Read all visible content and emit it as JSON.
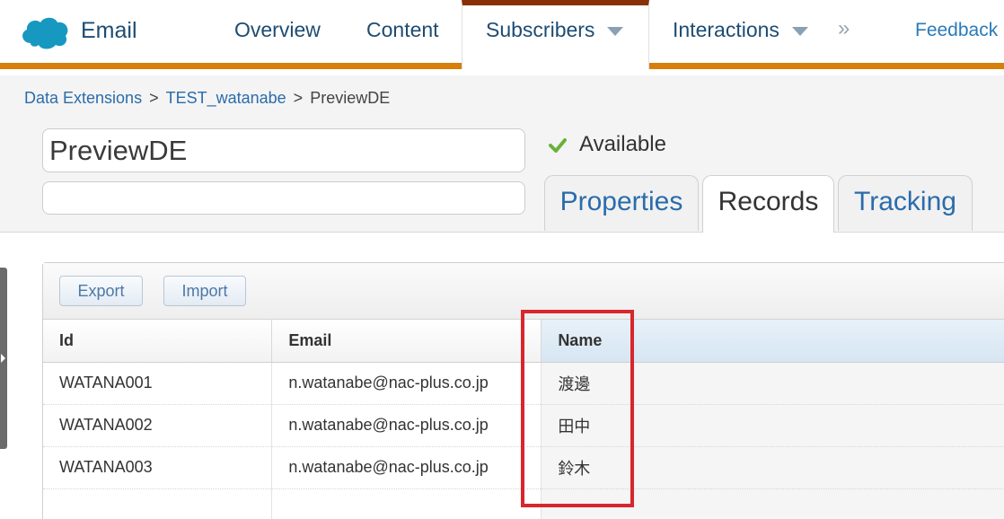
{
  "nav": {
    "app_name": "Email",
    "items": [
      "Overview",
      "Content",
      "Subscribers",
      "Interactions"
    ],
    "overflow": "»",
    "feedback": "Feedback",
    "active": "Subscribers"
  },
  "breadcrumb": {
    "items": [
      "Data Extensions",
      "TEST_watanabe",
      "PreviewDE"
    ],
    "separator": ">"
  },
  "data_extension": {
    "name": "PreviewDE",
    "description": "",
    "status": "Available"
  },
  "tabs": {
    "items": [
      "Properties",
      "Records",
      "Tracking"
    ],
    "active": "Records"
  },
  "toolbar": {
    "export_label": "Export",
    "import_label": "Import"
  },
  "table": {
    "columns": [
      "Id",
      "Email",
      "Name"
    ],
    "rows": [
      [
        "WATANA001",
        "n.watanabe@nac-plus.co.jp",
        "渡邊"
      ],
      [
        "WATANA002",
        "n.watanabe@nac-plus.co.jp",
        "田中"
      ],
      [
        "WATANA003",
        "n.watanabe@nac-plus.co.jp",
        "鈴木"
      ],
      [
        "",
        "",
        ""
      ]
    ]
  },
  "colors": {
    "nav_accent": "#d67f0a",
    "active_tab_top": "#8a3008",
    "link": "#2a6cab",
    "status_check": "#6ab13a",
    "highlight": "#d8262d"
  },
  "icons": {
    "logo": "salesforce-cloud-icon",
    "status": "check-icon",
    "nav_dropdown": "caret-down-icon",
    "edge": "collapse-handle-icon"
  }
}
